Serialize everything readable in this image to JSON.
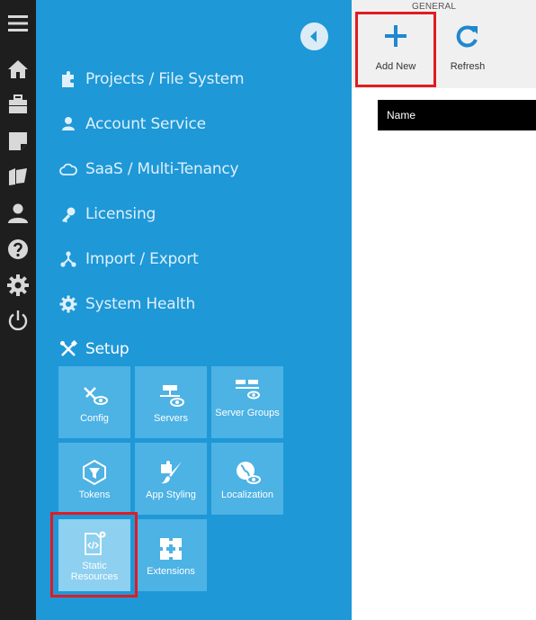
{
  "rail": {
    "items": [
      {
        "icon": "hamburger-menu-icon"
      },
      {
        "icon": "home-icon"
      },
      {
        "icon": "briefcase-icon"
      },
      {
        "icon": "note-icon"
      },
      {
        "icon": "folder-open-icon"
      },
      {
        "icon": "user-icon"
      },
      {
        "icon": "help-icon"
      },
      {
        "icon": "gear-icon"
      },
      {
        "icon": "power-icon"
      }
    ]
  },
  "nav": {
    "items": [
      {
        "label": "Projects / File System",
        "icon": "puzzle-icon"
      },
      {
        "label": "Account Service",
        "icon": "user-icon"
      },
      {
        "label": "SaaS / Multi-Tenancy",
        "icon": "cloud-icon"
      },
      {
        "label": "Licensing",
        "icon": "key-icon"
      },
      {
        "label": "Import / Export",
        "icon": "network-icon"
      },
      {
        "label": "System Health",
        "icon": "gear-heart-icon"
      },
      {
        "label": "Setup",
        "icon": "tools-icon"
      }
    ],
    "tiles": [
      {
        "label": "Config",
        "icon": "config-tools-icon"
      },
      {
        "label": "Servers",
        "icon": "server-icon"
      },
      {
        "label": "Server Groups",
        "icon": "server-groups-icon"
      },
      {
        "label": "Tokens",
        "icon": "token-filter-icon"
      },
      {
        "label": "App Styling",
        "icon": "brush-icon"
      },
      {
        "label": "Localization",
        "icon": "globe-icon"
      },
      {
        "label": "Static Resources",
        "icon": "code-file-icon"
      },
      {
        "label": "Extensions",
        "icon": "extensions-icon"
      }
    ]
  },
  "toolbar": {
    "group_label": "GENERAL",
    "add_label": "Add New",
    "refresh_label": "Refresh"
  },
  "grid": {
    "columns": [
      "Name"
    ]
  },
  "colors": {
    "rail": "#1e1e1e",
    "nav": "#1e98d7",
    "tile": "#4db2e4",
    "tile_selected": "#8dd0f0",
    "highlight": "#e11b22",
    "accent": "#1e88d0"
  }
}
